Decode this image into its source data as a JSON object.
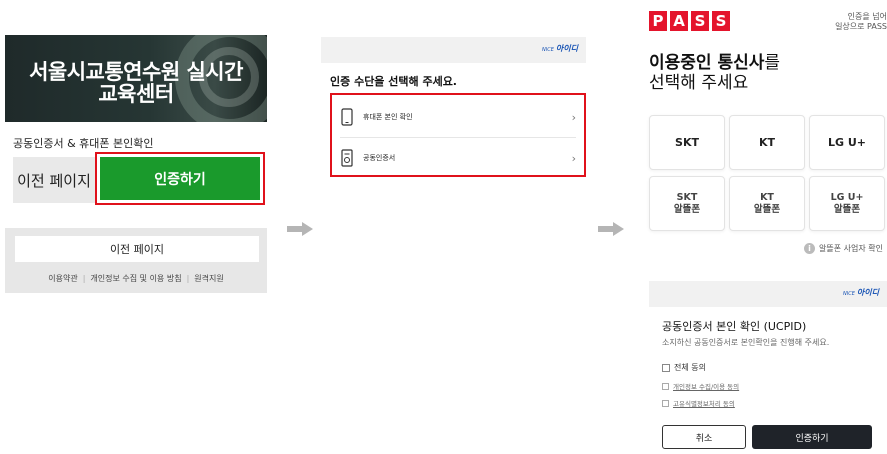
{
  "panel1": {
    "hero_title_line1": "서울시교통연수원 실시간",
    "hero_title_line2": "교육센터",
    "subtitle": "공동인증서 & 휴대폰 본인확인",
    "prev_button": "이전 페이지",
    "auth_button": "인증하기",
    "footer_prev_button": "이전 페이지",
    "footer_links": [
      "이용약관",
      "개인정보 수집 및 이용 방침",
      "원격지원"
    ],
    "accent_color": "#1a9a2c",
    "highlight_color": "#e0111b"
  },
  "panel2": {
    "provider_logo_small": "NICE",
    "provider_logo": "아이디",
    "title": "인증 수단을 선택해 주세요.",
    "methods": [
      {
        "label": "휴대폰 본인 확인",
        "icon": "smartphone-icon"
      },
      {
        "label": "공동인증서",
        "icon": "certificate-icon"
      }
    ],
    "highlight_color": "#e0111b"
  },
  "panel3": {
    "logo_letters": [
      "P",
      "A",
      "S",
      "S"
    ],
    "tagline_line1": "인증을 넘어",
    "tagline_line2": "일상으로 PASS",
    "title_bold": "이용중인 통신사",
    "title_suffix": "를",
    "title_line2": "선택해 주세요",
    "carriers": [
      "SKT",
      "KT",
      "LG U+"
    ],
    "mvno_carriers": [
      {
        "line1": "SKT",
        "line2": "알뜰폰"
      },
      {
        "line1": "KT",
        "line2": "알뜰폰"
      },
      {
        "line1": "LG U+",
        "line2": "알뜰폰"
      }
    ],
    "mvno_check": "알뜰폰 사업자 확인",
    "provider_logo_small": "NICE",
    "provider_logo": "아이디",
    "ucpid_title": "공동인증서 본인 확인 (UCPID)",
    "ucpid_desc": "소지하신 공동인증서로 본인확인을 진행해 주세요.",
    "agree_all": "전체 동의",
    "agree_items": [
      "개인정보 수집/이용 동의",
      "고유식별정보처리 동의"
    ],
    "cancel_button": "취소",
    "verify_button": "인증하기",
    "brand_color": "#e4142c"
  }
}
